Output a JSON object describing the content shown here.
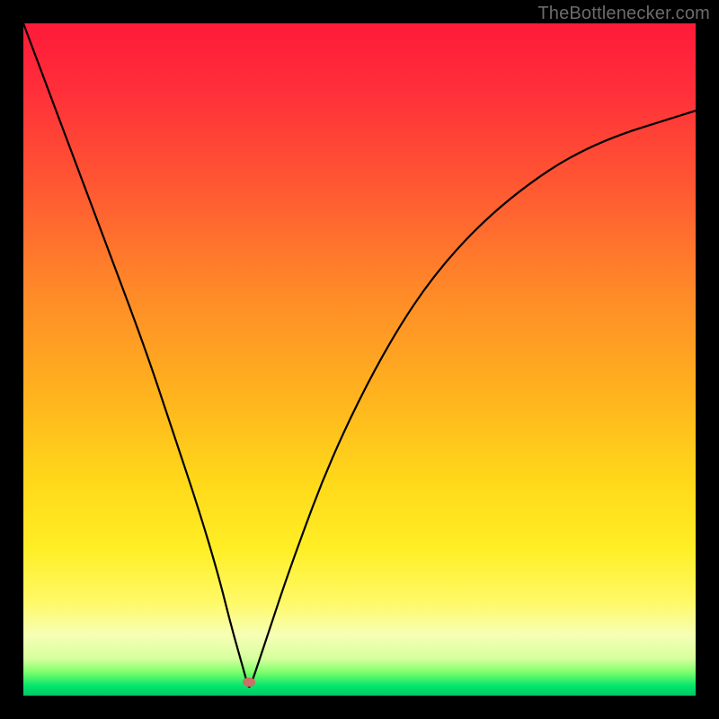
{
  "watermark": "TheBottlenecker.com",
  "marker": {
    "x_pct": 33.5,
    "y_pct": 98.0
  },
  "chart_data": {
    "type": "line",
    "title": "",
    "xlabel": "",
    "ylabel": "",
    "xlim": [
      0,
      100
    ],
    "ylim": [
      0,
      100
    ],
    "series": [
      {
        "name": "bottleneck-curve",
        "x": [
          0,
          6,
          12,
          18,
          22,
          26,
          29,
          31,
          33,
          33.5,
          34,
          36,
          40,
          46,
          54,
          62,
          72,
          84,
          100
        ],
        "y": [
          100,
          84,
          68,
          52,
          40,
          28,
          18,
          10,
          3,
          1,
          2,
          8,
          20,
          36,
          52,
          64,
          74,
          82,
          87
        ]
      }
    ],
    "optimum_point": {
      "x": 33.5,
      "y": 1
    },
    "background_gradient": {
      "top": "#ff1a3a",
      "mid": "#ffee25",
      "bottom": "#00c865"
    }
  }
}
